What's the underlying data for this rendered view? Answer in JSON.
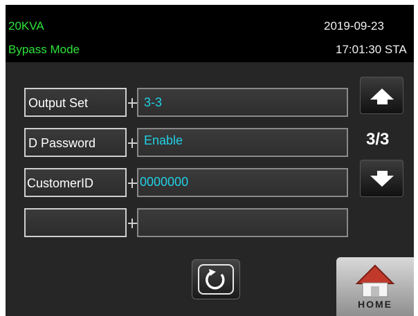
{
  "status": {
    "model": "20KVA",
    "mode": "Bypass Mode",
    "date": "2019-09-23",
    "time": "17:01:30 STA"
  },
  "settings": [
    {
      "label": "Output Set",
      "value": "3-3"
    },
    {
      "label": "D Password",
      "value": "Enable"
    },
    {
      "label": "CustomerID",
      "value": "0000000"
    },
    {
      "label": "",
      "value": ""
    }
  ],
  "pager": {
    "page": "3/3",
    "up_icon": "arrow-up-icon",
    "down_icon": "arrow-down-icon"
  },
  "footer": {
    "refresh_icon": "refresh-icon",
    "home_label": "HOME"
  },
  "colors": {
    "status_text": "#2ee33a",
    "value_text": "#21d0e6",
    "screen_bg": "#262626",
    "home_roof": "#c0392b"
  }
}
